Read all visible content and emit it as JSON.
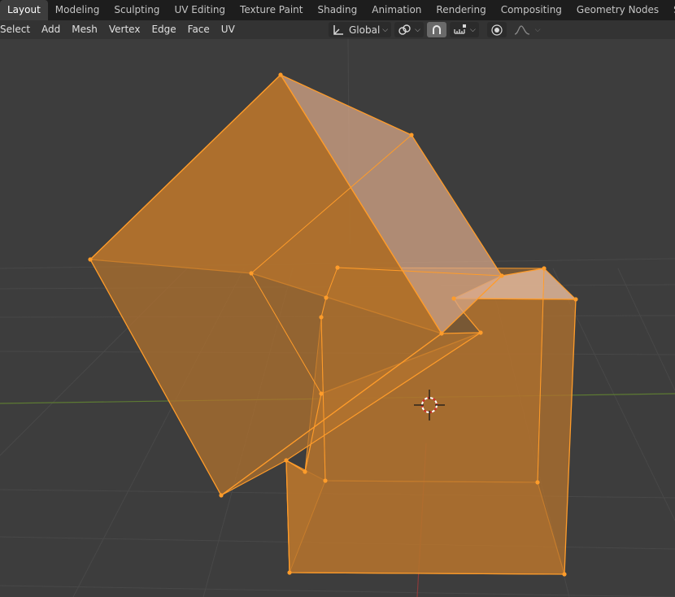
{
  "workspace_tabs": [
    {
      "label": "Layout",
      "active": true
    },
    {
      "label": "Modeling",
      "active": false
    },
    {
      "label": "Sculpting",
      "active": false
    },
    {
      "label": "UV Editing",
      "active": false
    },
    {
      "label": "Texture Paint",
      "active": false
    },
    {
      "label": "Shading",
      "active": false
    },
    {
      "label": "Animation",
      "active": false
    },
    {
      "label": "Rendering",
      "active": false
    },
    {
      "label": "Compositing",
      "active": false
    },
    {
      "label": "Geometry Nodes",
      "active": false
    },
    {
      "label": "Scripting",
      "active": false
    }
  ],
  "header_menus": [
    "Select",
    "Add",
    "Mesh",
    "Vertex",
    "Edge",
    "Face",
    "UV"
  ],
  "toolbar": {
    "orientation_label": "Global",
    "orientation_icon": "transform-orientation-icon",
    "pivot_icon": "pivot-point-icon",
    "snap_icon": "snap-magnet-icon",
    "snap_target_icon": "snap-increment-icon",
    "proportional_icon": "proportional-editing-icon",
    "falloff_icon": "falloff-curve-icon"
  },
  "colors": {
    "background": "#3d3d3d",
    "tabbar": "#1d1d1d",
    "selection": "#ff9c2a",
    "face_fill": "#b4732d",
    "grid": "#4a4a4a",
    "x_axis": "#8b3a3a",
    "y_axis": "#6a8a3a"
  }
}
